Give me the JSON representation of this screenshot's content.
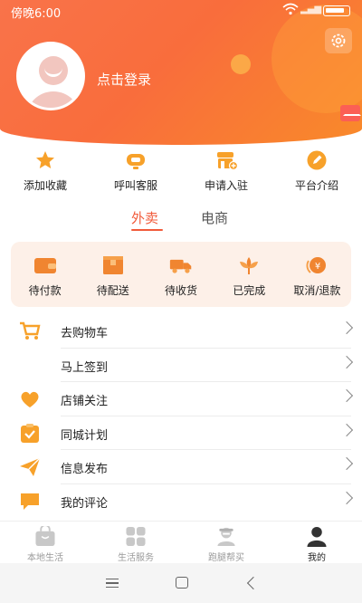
{
  "status": {
    "time": "傍晚6:00"
  },
  "profile": {
    "login_label": "点击登录"
  },
  "quick_actions": [
    {
      "label": "添加收藏",
      "icon": "star-icon"
    },
    {
      "label": "呼叫客服",
      "icon": "headset-icon"
    },
    {
      "label": "申请入驻",
      "icon": "store-add-icon"
    },
    {
      "label": "平台介绍",
      "icon": "pencil-icon"
    }
  ],
  "tabs": [
    {
      "label": "外卖",
      "active": true
    },
    {
      "label": "电商",
      "active": false
    }
  ],
  "orders": [
    {
      "label": "待付款",
      "icon": "wallet-icon"
    },
    {
      "label": "待配送",
      "icon": "box-icon"
    },
    {
      "label": "待收货",
      "icon": "truck-icon"
    },
    {
      "label": "已完成",
      "icon": "flower-icon"
    },
    {
      "label": "取消/退款",
      "icon": "yen-refund-icon"
    }
  ],
  "menu": [
    {
      "label": "去购物车",
      "icon": "cart-icon"
    },
    {
      "label": "马上签到",
      "icon": ""
    },
    {
      "label": "店铺关注",
      "icon": "heart-icon"
    },
    {
      "label": "同城计划",
      "icon": "clipboard-check-icon"
    },
    {
      "label": "信息发布",
      "icon": "paper-plane-icon"
    },
    {
      "label": "我的评论",
      "icon": "comment-icon"
    }
  ],
  "bottom_nav": [
    {
      "label": "本地生活",
      "icon": "bag-icon",
      "active": false
    },
    {
      "label": "生活服务",
      "icon": "grid-icon",
      "active": false
    },
    {
      "label": "跑腿帮买",
      "icon": "courier-icon",
      "active": false
    },
    {
      "label": "我的",
      "icon": "person-icon",
      "active": true
    }
  ],
  "colors": {
    "accent": "#f15a3a",
    "header_start": "#f9734a",
    "header_end": "#f98a2a",
    "icon_orange": "#f7a12a",
    "orders_bg": "#fdf0e8"
  }
}
